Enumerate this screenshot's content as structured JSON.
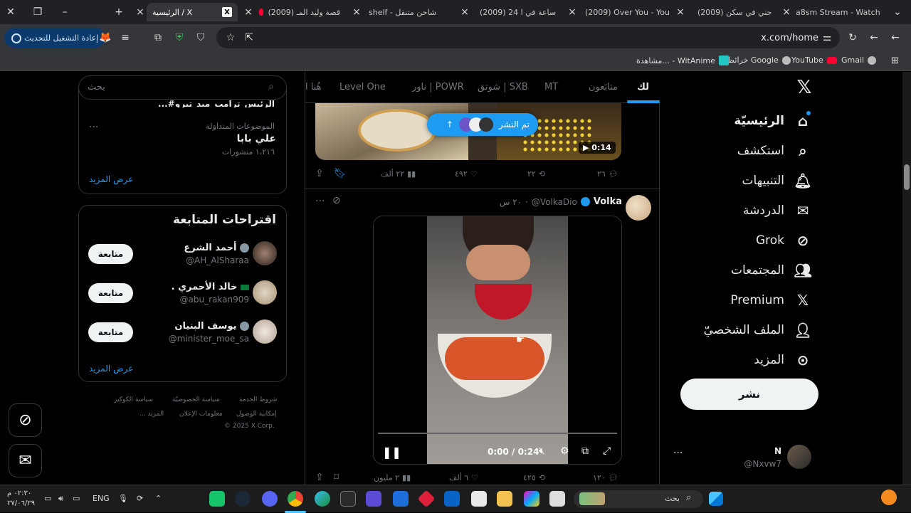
{
  "browser": {
    "tabs": [
      {
        "label": "a8sm Stream - Watch",
        "icon": "kick-icon"
      },
      {
        "label": "(2009) جني في سكن",
        "icon": "youtube-icon"
      },
      {
        "label": "(2009) Over You - You",
        "icon": "youtube-icon"
      },
      {
        "label": "(2009) 24 ساعة في ا",
        "icon": "youtube-icon"
      },
      {
        "label": "shelf - شاحن متنقل",
        "icon": "page-icon"
      },
      {
        "label": "(2009) قصة وليد المـ",
        "icon": "youtube-icon"
      },
      {
        "label": "الرئيسية / X",
        "icon": "x-icon",
        "active": true
      }
    ],
    "url": "x.com/home",
    "update_label": "إعادة التشغيل للتحديث",
    "bookmarks": [
      "Gmail",
      "YouTube",
      "خرائط Google",
      "مشاهدة... - WitAnime"
    ]
  },
  "x": {
    "nav": [
      {
        "label": "الرئيسيّة",
        "icon": "home-icon"
      },
      {
        "label": "استكشف",
        "icon": "search-icon"
      },
      {
        "label": "التنبيهات",
        "icon": "bell-icon"
      },
      {
        "label": "الدردشة",
        "icon": "mail-icon"
      },
      {
        "label": "Grok",
        "icon": "grok-icon"
      },
      {
        "label": "المجتمعات",
        "icon": "communities-icon"
      },
      {
        "label": "Premium",
        "icon": "x-logo-icon"
      },
      {
        "label": "الملف الشخصيّ",
        "icon": "profile-icon"
      },
      {
        "label": "المزيد",
        "icon": "more-icon"
      }
    ],
    "post_button": "نشر",
    "account": {
      "name": "N",
      "handle": "@Nxvw7"
    },
    "feed_tabs": [
      "لك",
      "متابَعون",
      "MT",
      "شوتق | SXB",
      "ناور | POWR",
      "Level One",
      "هُنا ا"
    ],
    "new_posts_pill": "تم النشر",
    "tweet1": {
      "video_time": "0:14",
      "replies": "٢٦",
      "reposts": "٢٢",
      "likes": "٤٩٢",
      "views": "٢٢ ألف"
    },
    "tweet2": {
      "name": "Volka",
      "handle": "@VolkaDio",
      "time": "٢٠ س",
      "video_time": "0:00 / 0:24",
      "replies": "١٢٠",
      "reposts": "٤٢٥",
      "likes": "٦ ألف",
      "views": "٢ مليون"
    }
  },
  "sidebar": {
    "search_placeholder": "بحث",
    "trend_cut": "...#الرئيس_ترامب_ميد_تيرو",
    "trend": {
      "context": "الموضوعات المتداوَلة",
      "title": "علي بابا",
      "count": "١،٢١٦ منشورات"
    },
    "show_more": "عرض المزيد",
    "suggest_title": "اقتراحات المتابعة",
    "suggestions": [
      {
        "name": "أحمد الشرع",
        "handle": "@AH_AlSharaa",
        "follow": "متابعة"
      },
      {
        "name": ". خالد الأحمري",
        "handle": "@abu_rakan909",
        "follow": "متابعة"
      },
      {
        "name": "يوسف البنيان",
        "handle": "@minister_moe_sa",
        "follow": "متابعة"
      }
    ],
    "show_more_2": "عرض المزيد",
    "footer": [
      "شروط الخدمة",
      "سياسة الخصوصيّة",
      "سياسة الكوكيز",
      "إمكانية الوصول",
      "معلومات الإعلان",
      "... المزيد",
      "© 2025 X Corp."
    ]
  },
  "taskbar": {
    "search_placeholder": "بحث",
    "lang": "ENG",
    "time": "٠٢:٣٠ م",
    "date": "٢٧/٠٦/٢٩"
  }
}
